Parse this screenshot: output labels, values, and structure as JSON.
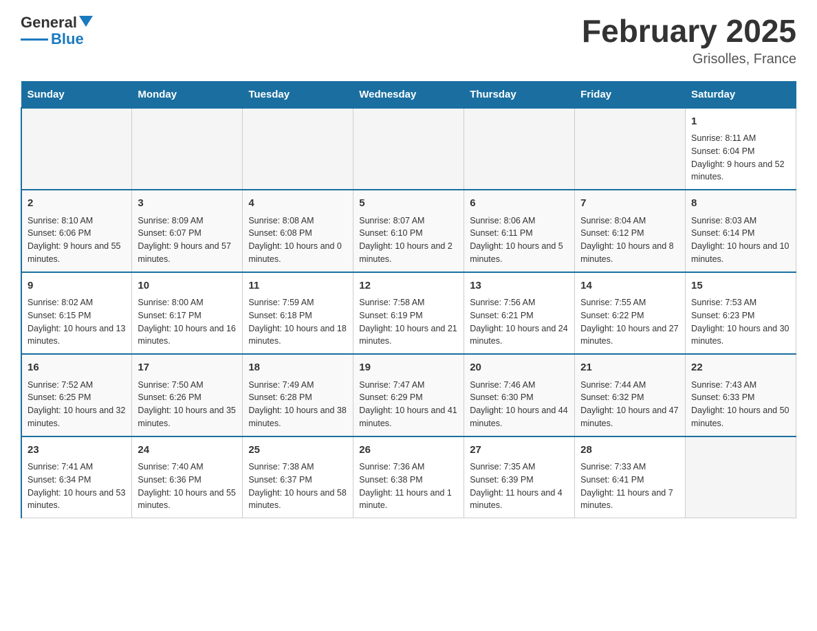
{
  "header": {
    "logo_general": "General",
    "logo_blue": "Blue",
    "title": "February 2025",
    "subtitle": "Grisolles, France"
  },
  "weekdays": [
    "Sunday",
    "Monday",
    "Tuesday",
    "Wednesday",
    "Thursday",
    "Friday",
    "Saturday"
  ],
  "weeks": [
    [
      {
        "day": "",
        "info": ""
      },
      {
        "day": "",
        "info": ""
      },
      {
        "day": "",
        "info": ""
      },
      {
        "day": "",
        "info": ""
      },
      {
        "day": "",
        "info": ""
      },
      {
        "day": "",
        "info": ""
      },
      {
        "day": "1",
        "info": "Sunrise: 8:11 AM\nSunset: 6:04 PM\nDaylight: 9 hours and 52 minutes."
      }
    ],
    [
      {
        "day": "2",
        "info": "Sunrise: 8:10 AM\nSunset: 6:06 PM\nDaylight: 9 hours and 55 minutes."
      },
      {
        "day": "3",
        "info": "Sunrise: 8:09 AM\nSunset: 6:07 PM\nDaylight: 9 hours and 57 minutes."
      },
      {
        "day": "4",
        "info": "Sunrise: 8:08 AM\nSunset: 6:08 PM\nDaylight: 10 hours and 0 minutes."
      },
      {
        "day": "5",
        "info": "Sunrise: 8:07 AM\nSunset: 6:10 PM\nDaylight: 10 hours and 2 minutes."
      },
      {
        "day": "6",
        "info": "Sunrise: 8:06 AM\nSunset: 6:11 PM\nDaylight: 10 hours and 5 minutes."
      },
      {
        "day": "7",
        "info": "Sunrise: 8:04 AM\nSunset: 6:12 PM\nDaylight: 10 hours and 8 minutes."
      },
      {
        "day": "8",
        "info": "Sunrise: 8:03 AM\nSunset: 6:14 PM\nDaylight: 10 hours and 10 minutes."
      }
    ],
    [
      {
        "day": "9",
        "info": "Sunrise: 8:02 AM\nSunset: 6:15 PM\nDaylight: 10 hours and 13 minutes."
      },
      {
        "day": "10",
        "info": "Sunrise: 8:00 AM\nSunset: 6:17 PM\nDaylight: 10 hours and 16 minutes."
      },
      {
        "day": "11",
        "info": "Sunrise: 7:59 AM\nSunset: 6:18 PM\nDaylight: 10 hours and 18 minutes."
      },
      {
        "day": "12",
        "info": "Sunrise: 7:58 AM\nSunset: 6:19 PM\nDaylight: 10 hours and 21 minutes."
      },
      {
        "day": "13",
        "info": "Sunrise: 7:56 AM\nSunset: 6:21 PM\nDaylight: 10 hours and 24 minutes."
      },
      {
        "day": "14",
        "info": "Sunrise: 7:55 AM\nSunset: 6:22 PM\nDaylight: 10 hours and 27 minutes."
      },
      {
        "day": "15",
        "info": "Sunrise: 7:53 AM\nSunset: 6:23 PM\nDaylight: 10 hours and 30 minutes."
      }
    ],
    [
      {
        "day": "16",
        "info": "Sunrise: 7:52 AM\nSunset: 6:25 PM\nDaylight: 10 hours and 32 minutes."
      },
      {
        "day": "17",
        "info": "Sunrise: 7:50 AM\nSunset: 6:26 PM\nDaylight: 10 hours and 35 minutes."
      },
      {
        "day": "18",
        "info": "Sunrise: 7:49 AM\nSunset: 6:28 PM\nDaylight: 10 hours and 38 minutes."
      },
      {
        "day": "19",
        "info": "Sunrise: 7:47 AM\nSunset: 6:29 PM\nDaylight: 10 hours and 41 minutes."
      },
      {
        "day": "20",
        "info": "Sunrise: 7:46 AM\nSunset: 6:30 PM\nDaylight: 10 hours and 44 minutes."
      },
      {
        "day": "21",
        "info": "Sunrise: 7:44 AM\nSunset: 6:32 PM\nDaylight: 10 hours and 47 minutes."
      },
      {
        "day": "22",
        "info": "Sunrise: 7:43 AM\nSunset: 6:33 PM\nDaylight: 10 hours and 50 minutes."
      }
    ],
    [
      {
        "day": "23",
        "info": "Sunrise: 7:41 AM\nSunset: 6:34 PM\nDaylight: 10 hours and 53 minutes."
      },
      {
        "day": "24",
        "info": "Sunrise: 7:40 AM\nSunset: 6:36 PM\nDaylight: 10 hours and 55 minutes."
      },
      {
        "day": "25",
        "info": "Sunrise: 7:38 AM\nSunset: 6:37 PM\nDaylight: 10 hours and 58 minutes."
      },
      {
        "day": "26",
        "info": "Sunrise: 7:36 AM\nSunset: 6:38 PM\nDaylight: 11 hours and 1 minute."
      },
      {
        "day": "27",
        "info": "Sunrise: 7:35 AM\nSunset: 6:39 PM\nDaylight: 11 hours and 4 minutes."
      },
      {
        "day": "28",
        "info": "Sunrise: 7:33 AM\nSunset: 6:41 PM\nDaylight: 11 hours and 7 minutes."
      },
      {
        "day": "",
        "info": ""
      }
    ]
  ]
}
